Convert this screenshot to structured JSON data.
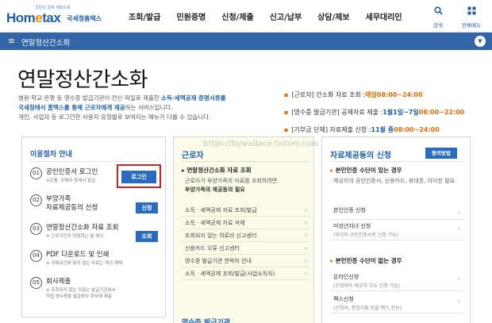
{
  "header": {
    "logo_tag": "국민의 일에 세정으로",
    "logo_text_a": "Hom",
    "logo_text_e": "e",
    "logo_text_b": "tax",
    "logo_sub": "국세청홈택스",
    "nav": [
      "조회/발급",
      "민원증명",
      "신청/제출",
      "신고/납부",
      "상담/제보",
      "세무대리인"
    ],
    "search_label": "검색",
    "menu_label": "전체메뉴"
  },
  "navbar": {
    "title": "연말정산간소화"
  },
  "hero": {
    "title": "연말정산간소화",
    "intro_1a": "병원·학교·은행 등 영수증 발급기관이 전산 파일로 제출한 ",
    "intro_1b": "소득·세액공제 증명서류를",
    "intro_2a": "국세청에서 홈택스를 통해 근로자에게 제공",
    "intro_2b": "하는 서비스입니다.",
    "intro_3": "개인, 사업자 등 로그인한 사용자 유형별로 보여지는 메뉴가 다를 수 있습니다."
  },
  "schedule": [
    {
      "label": "[근로자] 간소화 자료 조회 : ",
      "highlight": "매일 ",
      "time": "08:00~24:00"
    },
    {
      "label": "[영수증 발급기관] 공제자료 제출 : ",
      "highlight": "1월1일~7일 ",
      "time": "08:00~22:00"
    },
    {
      "label": "[기부금 단체] 자료제출 신청 : ",
      "highlight": "11월 중 ",
      "time": "08:00~24:00"
    }
  ],
  "procedure": {
    "title": "이용절차 안내",
    "steps": [
      {
        "num": "01",
        "label": "공인인증서 로그인",
        "note": "※은행, 우체국 등에서 발급",
        "button": "로그인"
      },
      {
        "num": "02",
        "label": "부양가족",
        "label2": "자료제공동의 신청",
        "button": "신청"
      },
      {
        "num": "03",
        "label": "연말정산간소화 자료 조회",
        "note": "※ 근무기간의 하정하는 월 체크",
        "button": "조회"
      },
      {
        "num": "04",
        "label": "PDF 다운로드 및 인쇄",
        "note": "※ 공제요건에 맞지 않는 자료는 체크 해제"
      },
      {
        "num": "05",
        "label": "회사제출",
        "note": "※ 조회되지 않는 자료는 발급기관에서",
        "note2": "직접 영수증을 발급받아 회사에 제출"
      }
    ]
  },
  "worker": {
    "title": "근로자",
    "sub": "연말정산간소화 자료 조회",
    "desc_1": "근로자가 부양가족의 자료를 조회하려면",
    "desc_2": "부양가족의 제공동의 필요",
    "links": [
      "소득 · 세액공제 자료 조회/발급",
      "소득 · 세액공제 자료 삭제",
      "조회되지 않는 의료비 신고센터",
      "신용카드 오류 신고센터",
      "영수증 발급기관 연락처 안내",
      "소득 · 세액공제 조회/발급(사업소득자)"
    ],
    "footer": "영수증 발급기관"
  },
  "consent": {
    "title": "자료제공동의 신청",
    "button": "동의방법",
    "sec_1": "본인인증 수단이 있는 경우",
    "text_1": "제공자의 공인인증서, 신용카드, 휴대폰, 아이핀 필요",
    "link_1": "본인인증 신청",
    "link_2": "미성년자녀 신청",
    "link_2_sub": "(부모의 공인인증서로 신청 가능)",
    "sec_2": "본인인증 수단이 없는 경우",
    "link_3": "온라인신청",
    "link_3_sub": "(조회자와 제공자 모두 신청 가능)",
    "link_4": "팩스신청",
    "link_4_sub": "(신청서, 증빙서류 등을 팩스 전송)"
  },
  "watermark": "https://bywallace.tistory.com",
  "colors": {
    "brand_blue": "#1f5fae",
    "nav_blue": "#3264a8",
    "accent_orange": "#e36c0a",
    "button_blue": "#2a6bc1",
    "highlight_red": "#d91c1c"
  }
}
